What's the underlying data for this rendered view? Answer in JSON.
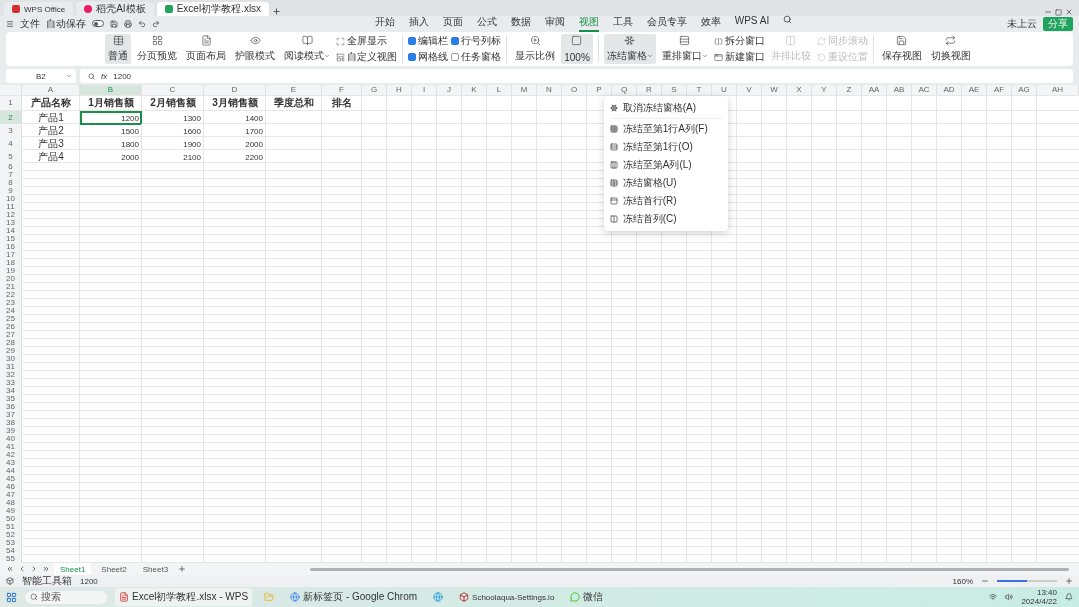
{
  "window": {
    "tabs": [
      {
        "label": "WPS Office",
        "kind": "home",
        "selected": false
      },
      {
        "label": "稻壳AI模板",
        "kind": "template",
        "selected": false
      },
      {
        "label": "Excel初学教程.xlsx",
        "kind": "sheet",
        "selected": true
      }
    ]
  },
  "quick_bar": {
    "menu": "文件",
    "autosave": {
      "label": "自动保存",
      "on": false
    }
  },
  "menu_tabs": [
    {
      "label": "开始",
      "selected": false
    },
    {
      "label": "插入",
      "selected": false
    },
    {
      "label": "页面",
      "selected": false
    },
    {
      "label": "公式",
      "selected": false
    },
    {
      "label": "数据",
      "selected": false
    },
    {
      "label": "审阅",
      "selected": false
    },
    {
      "label": "视图",
      "selected": true
    },
    {
      "label": "工具",
      "selected": false
    },
    {
      "label": "会员专享",
      "selected": false
    },
    {
      "label": "效率",
      "selected": false
    },
    {
      "label": "WPS AI",
      "selected": false
    }
  ],
  "cloud_status": "未上云",
  "share": "分享",
  "ribbon": [
    {
      "columns": [
        {
          "kind": "large",
          "label": "普通",
          "selected": true
        },
        {
          "kind": "large",
          "label": "分页预览",
          "selected": false
        },
        {
          "kind": "large",
          "label": "页面布局",
          "selected": false
        },
        {
          "kind": "large",
          "label": "护眼模式",
          "selected": false
        },
        {
          "kind": "large",
          "label": "阅读模式",
          "selected": false,
          "dropdown": true
        },
        {
          "kind": "stack",
          "items": [
            {
              "kind": "small",
              "label": "全屏显示"
            },
            {
              "kind": "small",
              "label": "自定义视图"
            }
          ]
        }
      ]
    },
    {
      "columns": [
        {
          "kind": "stack",
          "items": [
            {
              "kind": "check",
              "label": "编辑栏",
              "checked": true
            },
            {
              "kind": "check",
              "label": "网格线",
              "checked": true
            }
          ]
        },
        {
          "kind": "stack",
          "items": [
            {
              "kind": "check",
              "label": "行号列标",
              "checked": true
            },
            {
              "kind": "check",
              "label": "任务窗格",
              "checked": false
            }
          ]
        }
      ]
    },
    {
      "columns": [
        {
          "kind": "large",
          "label": "显示比例",
          "selected": false
        },
        {
          "kind": "large",
          "label": "100%",
          "selected": true
        }
      ]
    },
    {
      "columns": [
        {
          "kind": "large",
          "label": "冻结窗格",
          "selected": true,
          "dropdown": true,
          "menu": true
        },
        {
          "kind": "large",
          "label": "重排窗口",
          "selected": false,
          "dropdown": true
        },
        {
          "kind": "stack",
          "items": [
            {
              "kind": "small",
              "label": "拆分窗口",
              "disabled": false
            },
            {
              "kind": "small",
              "label": "新建窗口",
              "disabled": false
            }
          ]
        },
        {
          "kind": "large",
          "label": "并排比较",
          "selected": false,
          "disabled": true
        },
        {
          "kind": "stack",
          "items": [
            {
              "kind": "small",
              "label": "同步滚动",
              "disabled": true
            },
            {
              "kind": "small",
              "label": "重设位置",
              "disabled": true
            }
          ]
        }
      ]
    },
    {
      "columns": [
        {
          "kind": "large",
          "label": "保存视图",
          "selected": false
        },
        {
          "kind": "large",
          "label": "切换视图",
          "selected": false
        }
      ]
    }
  ],
  "freeze_menu": [
    "取消冻结窗格(A)",
    "冻结至第1行A列(F)",
    "冻结至第1行(O)",
    "冻结至第A列(L)",
    "冻结窗格(U)",
    "冻结首行(R)",
    "冻结首列(C)"
  ],
  "formula_bar": {
    "name_box": "B2",
    "fx": "fx",
    "value": "1200"
  },
  "sheet": {
    "columns": [
      {
        "label": "A",
        "selected": false
      },
      {
        "label": "B",
        "selected": true
      },
      {
        "label": "C",
        "selected": false
      },
      {
        "label": "D",
        "selected": false
      },
      {
        "label": "E",
        "selected": false
      },
      {
        "label": "F",
        "selected": false
      },
      {
        "label": "G",
        "selected": false
      },
      {
        "label": "H",
        "selected": false
      },
      {
        "label": "I",
        "selected": false
      },
      {
        "label": "J",
        "selected": false
      },
      {
        "label": "K",
        "selected": false
      },
      {
        "label": "L",
        "selected": false
      },
      {
        "label": "M",
        "selected": false
      },
      {
        "label": "N",
        "selected": false
      },
      {
        "label": "O",
        "selected": false
      },
      {
        "label": "P",
        "selected": false
      },
      {
        "label": "Q",
        "selected": false
      },
      {
        "label": "R",
        "selected": false
      },
      {
        "label": "S",
        "selected": false
      },
      {
        "label": "T",
        "selected": false
      },
      {
        "label": "U",
        "selected": false
      },
      {
        "label": "V",
        "selected": false
      },
      {
        "label": "W",
        "selected": false
      },
      {
        "label": "X",
        "selected": false
      },
      {
        "label": "Y",
        "selected": false
      },
      {
        "label": "Z",
        "selected": false
      },
      {
        "label": "AA",
        "selected": false
      },
      {
        "label": "AB",
        "selected": false
      },
      {
        "label": "AC",
        "selected": false
      },
      {
        "label": "AD",
        "selected": false
      },
      {
        "label": "AE",
        "selected": false
      },
      {
        "label": "AF",
        "selected": false
      },
      {
        "label": "AG",
        "selected": false
      },
      {
        "label": "AH",
        "selected": false
      }
    ],
    "rows": [
      {
        "number": "1",
        "selected": false,
        "kind": "header",
        "cells": [
          {
            "text": "产品名称",
            "selected": false
          },
          {
            "text": "1月销售额",
            "selected": false
          },
          {
            "text": "2月销售额",
            "selected": false
          },
          {
            "text": "3月销售额",
            "selected": false
          },
          {
            "text": "季度总和",
            "selected": false
          },
          {
            "text": "排名",
            "selected": false
          }
        ]
      },
      {
        "number": "2",
        "selected": true,
        "kind": "data",
        "cells": [
          {
            "text": "产品1",
            "selected": false
          },
          {
            "text": "1200",
            "selected": true
          },
          {
            "text": "1300",
            "selected": false
          },
          {
            "text": "1400",
            "selected": false
          }
        ]
      },
      {
        "number": "3",
        "selected": false,
        "kind": "data",
        "cells": [
          {
            "text": "产品2",
            "selected": false
          },
          {
            "text": "1500",
            "selected": false
          },
          {
            "text": "1600",
            "selected": false
          },
          {
            "text": "1700",
            "selected": false
          }
        ]
      },
      {
        "number": "4",
        "selected": false,
        "kind": "data",
        "cells": [
          {
            "text": "产品3",
            "selected": false
          },
          {
            "text": "1800",
            "selected": false
          },
          {
            "text": "1900",
            "selected": false
          },
          {
            "text": "2000",
            "selected": false
          }
        ]
      },
      {
        "number": "5",
        "selected": false,
        "kind": "data",
        "cells": [
          {
            "text": "产品4",
            "selected": false
          },
          {
            "text": "2000",
            "selected": false
          },
          {
            "text": "2100",
            "selected": false
          },
          {
            "text": "2200",
            "selected": false
          }
        ]
      }
    ],
    "empty_rows": [
      "6",
      "7",
      "8",
      "9",
      "10",
      "11",
      "12",
      "13",
      "14",
      "15",
      "16",
      "17",
      "18",
      "19",
      "20",
      "21",
      "22",
      "23",
      "24",
      "25",
      "26",
      "27",
      "28",
      "29",
      "30",
      "31",
      "32",
      "33",
      "34",
      "35",
      "36",
      "37",
      "38",
      "39",
      "40",
      "41",
      "42",
      "43",
      "44",
      "45",
      "46",
      "47",
      "48",
      "49",
      "50",
      "51",
      "52",
      "53",
      "54",
      "55"
    ]
  },
  "sheet_tabs": [
    {
      "label": "Sheet1",
      "selected": true
    },
    {
      "label": "Sheet2",
      "selected": false
    },
    {
      "label": "Sheet3",
      "selected": false
    }
  ],
  "status_bar": {
    "toolbox": "智能工具箱",
    "value": "1200",
    "zoom": "160%",
    "zoom_level": {
      "level": 0.5
    }
  },
  "taskbar": {
    "search": {
      "placeholder": "搜索"
    },
    "apps": [
      {
        "label": "Excel初学教程.xlsx - WPS",
        "kind": "wps",
        "selected": true
      },
      {
        "kind": "files",
        "selected": false
      },
      {
        "label": "新标签页 - Google Chrom",
        "kind": "chrome",
        "selected": false
      },
      {
        "kind": "edge",
        "selected": false
      },
      {
        "label": "Schoolaqua-Settings.io",
        "kind": "app",
        "selected": false
      },
      {
        "label": "微信",
        "kind": "wechat",
        "selected": false
      }
    ],
    "time": "13:40",
    "date": "2024/4/22"
  }
}
